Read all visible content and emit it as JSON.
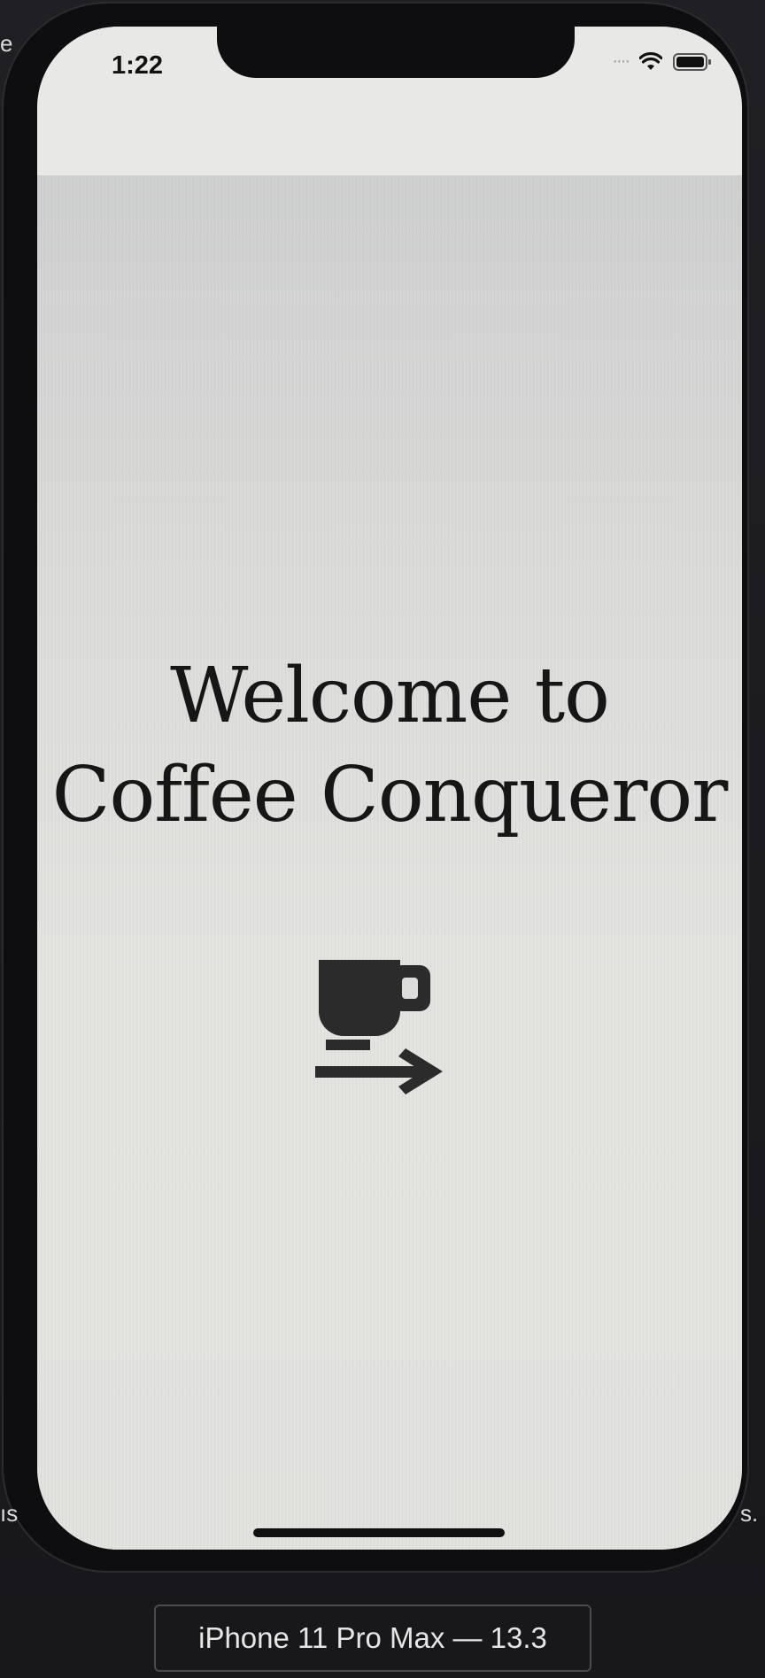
{
  "status_bar": {
    "time": "1:22"
  },
  "main": {
    "title_line1": "Welcome to",
    "title_line2": "Coffee Conqueror",
    "enter_icon": "coffee-cup-arrow-icon"
  },
  "simulator": {
    "device_label": "iPhone 11 Pro Max — 13.3"
  },
  "colors": {
    "text": "#161616",
    "background": "#e3e3e1",
    "frame": "#0e0e10"
  }
}
